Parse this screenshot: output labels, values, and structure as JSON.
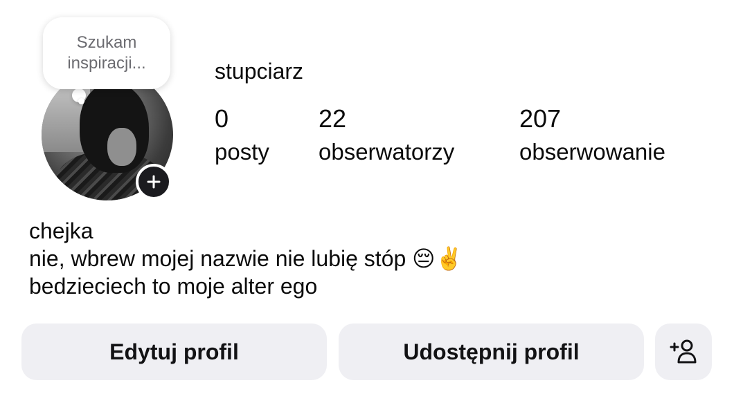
{
  "profile": {
    "note": "Szukam inspiracji...",
    "username": "stupciarz",
    "stats": {
      "posts_count": "0",
      "posts_label": "posty",
      "followers_count": "22",
      "followers_label": "obserwatorzy",
      "following_count": "207",
      "following_label": "obserwowanie"
    },
    "bio": {
      "line1": "chejka",
      "line2": "nie, wbrew mojej nazwie nie lubię stóp 😔✌️",
      "line3": "bedzieciech to moje alter ego"
    }
  },
  "actions": {
    "edit_label": "Edytuj profil",
    "share_label": "Udostępnij profil",
    "add_icon": "add-person-icon"
  },
  "icons": {
    "add_story": "plus-icon"
  }
}
